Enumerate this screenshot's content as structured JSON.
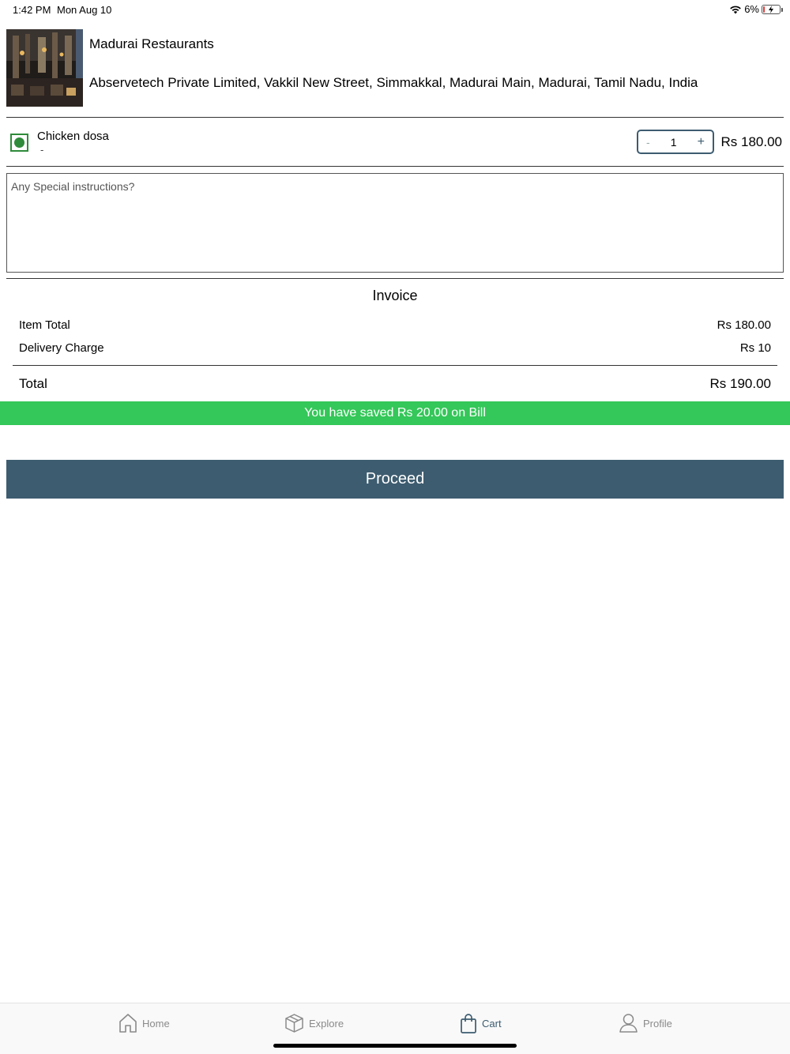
{
  "status_bar": {
    "time": "1:42 PM",
    "date": "Mon Aug 10",
    "battery": "6%"
  },
  "restaurant": {
    "name": "Madurai Restaurants",
    "address": "Abservetech Private Limited, Vakkil New Street, Simmakkal, Madurai Main, Madurai, Tamil Nadu, India",
    "image": "restaurant-interior-photo"
  },
  "cart_item": {
    "name": "Chicken dosa",
    "subtitle": "-",
    "quantity": "1",
    "minus_label": "-",
    "plus_label": "+",
    "price": "Rs 180.00",
    "veg_indicator_color": "#2e8b3a"
  },
  "instructions": {
    "placeholder": "Any Special instructions?",
    "value": ""
  },
  "invoice": {
    "title": "Invoice",
    "rows": [
      {
        "label": "Item Total",
        "value": "Rs 180.00"
      },
      {
        "label": "Delivery Charge",
        "value": "Rs 10"
      }
    ],
    "total_label": "Total",
    "total_value": "Rs 190.00"
  },
  "savings_banner": {
    "text": "You have saved Rs 20.00  on Bill",
    "color": "#34c759"
  },
  "proceed_button": {
    "label": "Proceed",
    "color": "#3d5c70"
  },
  "tab_bar": {
    "tabs": [
      {
        "label": "Home",
        "icon": "home-icon",
        "active": false
      },
      {
        "label": "Explore",
        "icon": "box-icon",
        "active": false
      },
      {
        "label": "Cart",
        "icon": "shopping-bag-icon",
        "active": true
      },
      {
        "label": "Profile",
        "icon": "user-icon",
        "active": false
      }
    ]
  }
}
